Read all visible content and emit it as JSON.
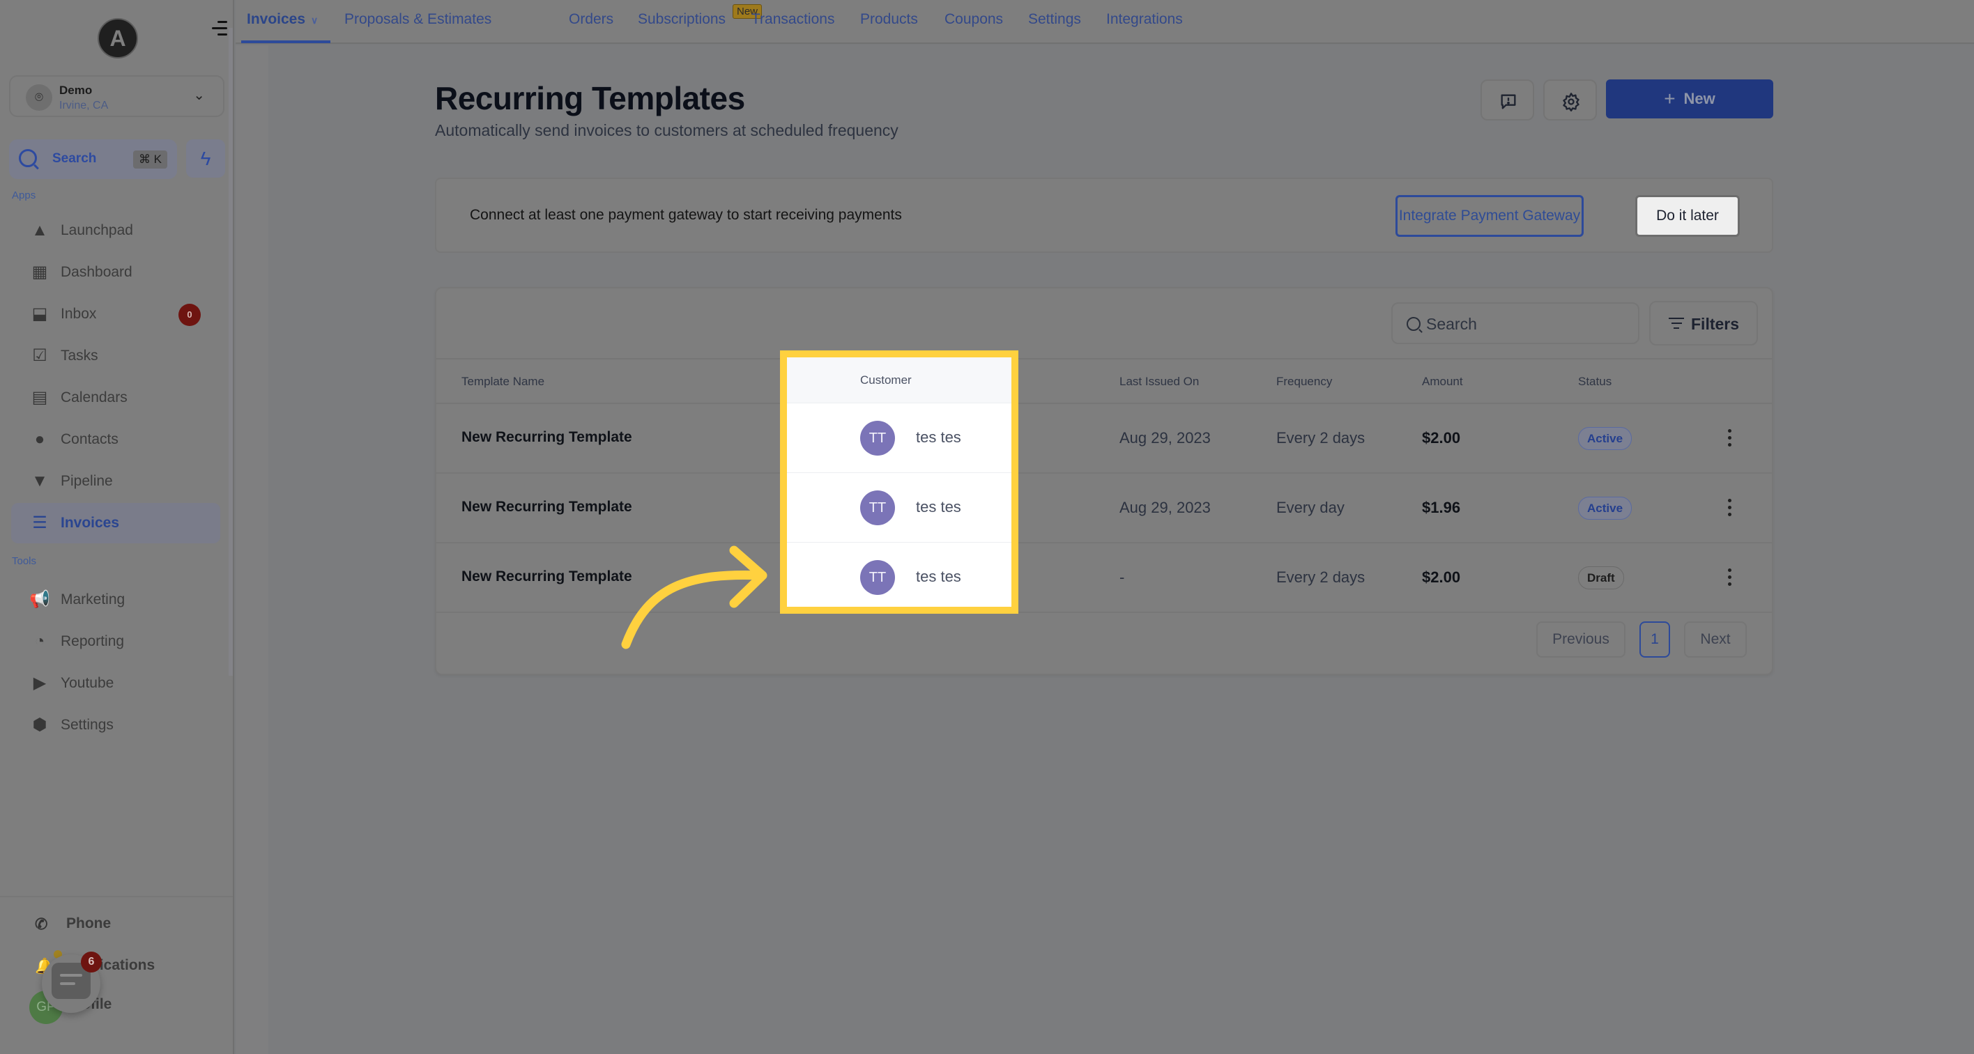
{
  "sidebar": {
    "logo_letter": "A",
    "location": {
      "name": "Demo",
      "subtitle": "Irvine, CA"
    },
    "search": {
      "label": "Search",
      "shortcut": "⌘ K"
    },
    "sections": {
      "apps": "Apps",
      "tools": "Tools"
    },
    "apps": [
      {
        "label": "Launchpad",
        "icon": "rocket-icon"
      },
      {
        "label": "Dashboard",
        "icon": "dashboard-icon"
      },
      {
        "label": "Inbox",
        "icon": "inbox-icon",
        "badge": "0"
      },
      {
        "label": "Tasks",
        "icon": "clipboard-check-icon"
      },
      {
        "label": "Calendars",
        "icon": "calendar-icon"
      },
      {
        "label": "Contacts",
        "icon": "person-icon"
      },
      {
        "label": "Pipeline",
        "icon": "funnel-icon"
      },
      {
        "label": "Invoices",
        "icon": "receipt-icon",
        "active": true
      }
    ],
    "tools": [
      {
        "label": "Marketing",
        "icon": "megaphone-icon"
      },
      {
        "label": "Reporting",
        "icon": "pie-chart-icon"
      },
      {
        "label": "Youtube",
        "icon": "youtube-icon"
      },
      {
        "label": "Settings",
        "icon": "settings-icon"
      }
    ],
    "bottom": [
      {
        "label": "Phone",
        "icon": "phone-icon"
      },
      {
        "label": "Notifications",
        "icon": "bell-icon"
      },
      {
        "label": "Profile",
        "icon": "avatar"
      }
    ],
    "profile_initials": "GP",
    "chat_widget_badge": "6"
  },
  "topnav": {
    "tabs": [
      {
        "label": "Invoices",
        "active": true,
        "has_dropdown": true
      },
      {
        "label": "Proposals & Estimates",
        "pill": "New"
      },
      {
        "label": "Orders"
      },
      {
        "label": "Subscriptions"
      },
      {
        "label": "Transactions"
      },
      {
        "label": "Products"
      },
      {
        "label": "Coupons"
      },
      {
        "label": "Settings"
      },
      {
        "label": "Integrations"
      }
    ]
  },
  "page": {
    "title": "Recurring Templates",
    "subtitle": "Automatically send invoices to customers at scheduled frequency",
    "new_button": "New"
  },
  "banner": {
    "text": "Connect at least one payment gateway to start receiving payments",
    "primary_action": "Integrate Payment Gateway",
    "secondary_action": "Do it later"
  },
  "table": {
    "search_placeholder": "Search",
    "filters_label": "Filters",
    "columns": [
      "Template Name",
      "Customer",
      "Last Issued On",
      "Frequency",
      "Amount",
      "Status"
    ],
    "rows": [
      {
        "name": "New Recurring Template",
        "customer_initials": "TT",
        "customer": "tes tes",
        "last_issued": "Aug 29, 2023",
        "frequency": "Every 2 days",
        "amount": "$2.00",
        "status": "Active"
      },
      {
        "name": "New Recurring Template",
        "customer_initials": "TT",
        "customer": "tes tes",
        "last_issued": "Aug 29, 2023",
        "frequency": "Every day",
        "amount": "$1.96",
        "status": "Active"
      },
      {
        "name": "New Recurring Template",
        "customer_initials": "TT",
        "customer": "tes tes",
        "last_issued": "-",
        "frequency": "Every 2 days",
        "amount": "$2.00",
        "status": "Draft"
      }
    ],
    "pagination": {
      "previous": "Previous",
      "current_page": "1",
      "next": "Next"
    }
  },
  "annotation": {
    "highlight_color": "#FFD13F",
    "target": "Customer column"
  },
  "colors": {
    "accent": "#2D4A9A",
    "avatar": "#7B74B7",
    "highlight": "#FFD13F"
  }
}
